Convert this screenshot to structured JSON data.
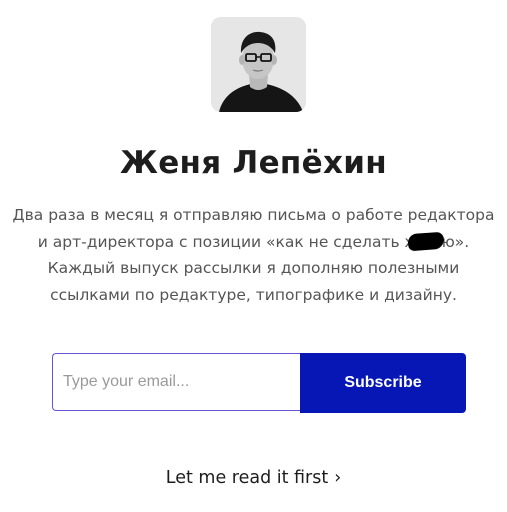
{
  "profile": {
    "name": "Женя Лепёхин",
    "description": {
      "line1": "Два раза в месяц я отправляю письма о работе редактора",
      "line2_before": "и арт-директора с позиции «как не сделать х",
      "line2_after": "ю».",
      "line3": "Каждый выпуск рассылки я дополняю полезными",
      "line4": "ссылками по редактуре, типографике и дизайну."
    }
  },
  "form": {
    "email_placeholder": "Type your email...",
    "email_value": "",
    "subscribe_label": "Subscribe"
  },
  "read_first": {
    "label": "Let me read it first",
    "chevron": "›"
  },
  "colors": {
    "accent": "#0617b6",
    "input_border": "#6655d6",
    "text_dark": "#1d1d1d",
    "text_muted": "#555555"
  }
}
